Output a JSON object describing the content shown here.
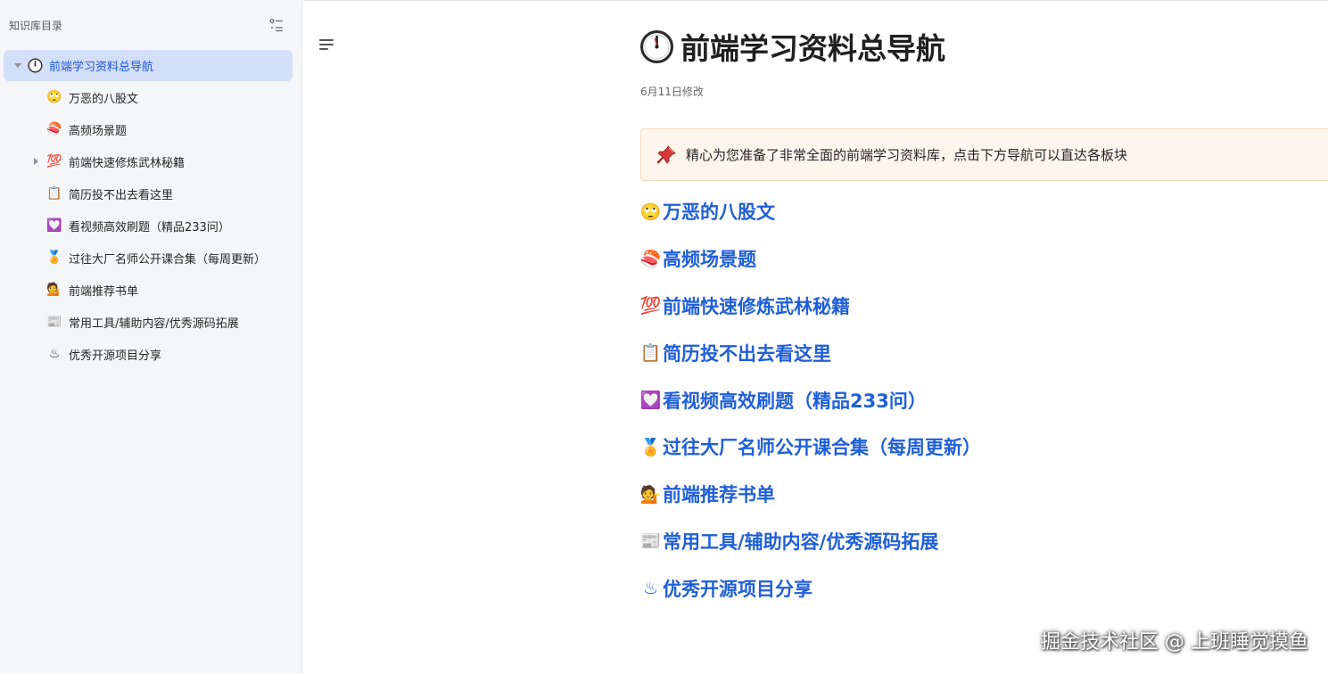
{
  "sidebar": {
    "title": "知识库目录",
    "items": [
      {
        "label": "前端学习资料总导航",
        "icon": "clock-icon",
        "glyph": "🕛",
        "active": true,
        "expanded": true
      },
      {
        "label": "万恶的八股文",
        "icon": "eyeroll-face-icon",
        "glyph": "🙄"
      },
      {
        "label": "高频场景题",
        "icon": "sushi-icon",
        "glyph": "🍣"
      },
      {
        "label": "前端快速修炼武林秘籍",
        "icon": "hundred-points-icon",
        "glyph": "💯",
        "has_children": true
      },
      {
        "label": "简历投不出去看这里",
        "icon": "clipboard-icon",
        "glyph": "📋"
      },
      {
        "label": "看视频高效刷题（精品233问）",
        "icon": "heart-badge-icon",
        "glyph": "💟"
      },
      {
        "label": "过往大厂名师公开课合集（每周更新）",
        "icon": "medal-icon",
        "glyph": "🏅"
      },
      {
        "label": "前端推荐书单",
        "icon": "person-tipping-hand-icon",
        "glyph": "💁"
      },
      {
        "label": "常用工具/辅助内容/优秀源码拓展",
        "icon": "newspaper-icon",
        "glyph": "📰"
      },
      {
        "label": "优秀开源项目分享",
        "icon": "hot-springs-icon",
        "glyph": "♨"
      }
    ]
  },
  "doc": {
    "title": "前端学习资料总导航",
    "title_icon": "clock-icon",
    "meta": "6月11日修改",
    "callout": {
      "icon": "pushpin-icon",
      "text": "精心为您准备了非常全面的前端学习资料库，点击下方导航可以直达各板块"
    },
    "links": [
      {
        "label": "万恶的八股文",
        "icon": "eyeroll-face-icon",
        "glyph": "🙄"
      },
      {
        "label": "高频场景题",
        "icon": "sushi-icon",
        "glyph": "🍣"
      },
      {
        "label": "前端快速修炼武林秘籍",
        "icon": "hundred-points-icon",
        "glyph": "💯"
      },
      {
        "label": "简历投不出去看这里",
        "icon": "clipboard-icon",
        "glyph": "📋"
      },
      {
        "label": "看视频高效刷题（精品233问）",
        "icon": "heart-badge-icon",
        "glyph": "💟"
      },
      {
        "label": "过往大厂名师公开课合集（每周更新）",
        "icon": "medal-icon",
        "glyph": "🏅"
      },
      {
        "label": "前端推荐书单",
        "icon": "person-tipping-hand-icon",
        "glyph": "💁"
      },
      {
        "label": "常用工具/辅助内容/优秀源码拓展",
        "icon": "newspaper-icon",
        "glyph": "📰"
      },
      {
        "label": "优秀开源项目分享",
        "icon": "hot-springs-icon",
        "glyph": "♨"
      }
    ]
  },
  "watermark": "掘金技术社区 @ 上班睡觉摸鱼",
  "colors": {
    "link": "#1f5fd8",
    "active_bg": "#d3def8",
    "sidebar_bg": "#f5f6f7",
    "callout_bg": "#fef5ec",
    "callout_border": "#f7d9bf"
  }
}
